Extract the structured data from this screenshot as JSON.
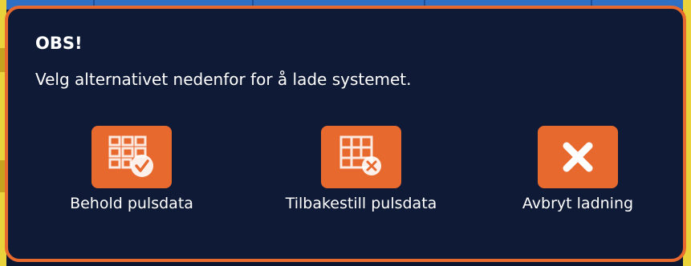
{
  "dialog": {
    "title": "OBS!",
    "message": "Velg alternativet nedenfor for å lade systemet."
  },
  "options": [
    {
      "label": "Behold pulsdata",
      "icon": "grid-check-icon"
    },
    {
      "label": "Tilbakestill pulsdata",
      "icon": "grid-x-icon"
    },
    {
      "label": "Avbryt ladning",
      "icon": "close-icon"
    }
  ],
  "colors": {
    "accent": "#e8692e",
    "dialog_background": "#0f1a36",
    "text": "#ffffff",
    "background_strip": "#2f6fc4",
    "side_strip": "#e9d23a"
  }
}
